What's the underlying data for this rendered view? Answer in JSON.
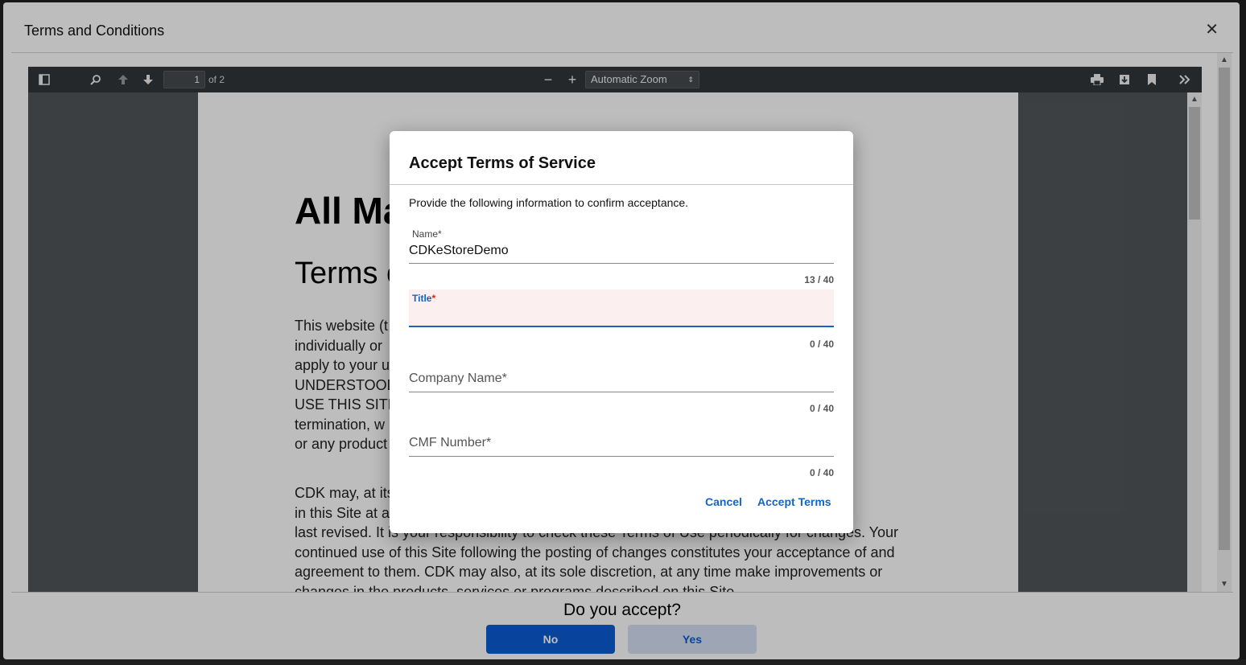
{
  "terms_modal": {
    "title": "Terms and Conditions",
    "close_glyph": "✕"
  },
  "pdf_toolbar": {
    "sidebar_icon": "sidebar-toggle-icon",
    "current_page": "1",
    "page_of": "of 2",
    "zoom_out_glyph": "−",
    "zoom_in_glyph": "+",
    "zoom_value": "Automatic Zoom",
    "zoom_caret": "⇕"
  },
  "pdf_page": {
    "heading": "All Ma",
    "subheading": "Terms o",
    "para1_lines": [
      "This website (t                                                                                  affiliates,",
      "individually or                                                                                   Use”)",
      "apply to your u                                                                               VE READ,",
      "UNDERSTOOD                                                                                DO NOT",
      "USE THIS SITE.                                                                              atic",
      "termination, w                                                                             f this Site",
      "or any product"
    ],
    "para2_lines": [
      "CDK may, at its                                                                             contained",
      "in this Site at a                                                                             Jse were",
      "last revised. It is your responsibility to check these Terms of Use periodically for changes. Your",
      "continued use of this Site following the posting of changes constitutes your acceptance of and",
      "agreement to them. CDK may also, at its sole discretion, at any time make improvements or",
      "changes in the products, services or programs described on this Site"
    ]
  },
  "footer": {
    "question": "Do you accept?",
    "no_label": "No",
    "yes_label": "Yes"
  },
  "dialog": {
    "title": "Accept Terms of Service",
    "description": "Provide the following information to confirm acceptance.",
    "fields": {
      "name": {
        "label": "Name",
        "value": "CDKeStoreDemo",
        "counter": "13 / 40"
      },
      "title": {
        "label": "Title",
        "value": "",
        "counter": "0 / 40"
      },
      "company": {
        "label": "Company Name",
        "value": "",
        "counter": "0 / 40"
      },
      "cmf": {
        "label": "CMF Number",
        "value": "",
        "counter": "0 / 40"
      }
    },
    "required_mark": "*",
    "cancel_label": "Cancel",
    "accept_label": "Accept Terms"
  },
  "colors": {
    "primary": "#0b5cd5",
    "link": "#1565c0",
    "toolbar": "#323639",
    "pdf_bg": "#525659"
  }
}
